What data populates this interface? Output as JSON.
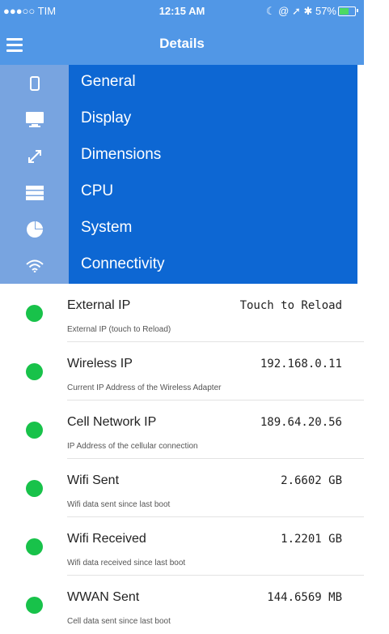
{
  "status_bar": {
    "carrier": "●●●○○ TIM",
    "time": "12:15 AM",
    "right_text": "☾ @ ➚ ✱ 57%",
    "battery_percent": 57
  },
  "nav": {
    "title": "Details"
  },
  "menu": {
    "items": [
      {
        "label": "General",
        "icon": "phone-icon"
      },
      {
        "label": "Display",
        "icon": "monitor-icon"
      },
      {
        "label": "Dimensions",
        "icon": "expand-icon"
      },
      {
        "label": "CPU",
        "icon": "server-icon"
      },
      {
        "label": "System",
        "icon": "pie-chart-icon"
      },
      {
        "label": "Connectivity",
        "icon": "wifi-icon"
      }
    ]
  },
  "rows": [
    {
      "name": "External IP",
      "value": "Touch to Reload",
      "desc": "External IP (touch to Reload)"
    },
    {
      "name": "Wireless IP",
      "value": "192.168.0.11",
      "desc": "Current IP Address of the Wireless Adapter"
    },
    {
      "name": "Cell Network IP",
      "value": "189.64.20.56",
      "desc": "IP Address of the cellular connection"
    },
    {
      "name": "Wifi Sent",
      "value": "2.6602 GB",
      "desc": "Wifi data sent since last boot"
    },
    {
      "name": "Wifi Received",
      "value": "1.2201 GB",
      "desc": "Wifi data received since last boot"
    },
    {
      "name": "WWAN Sent",
      "value": "144.6569 MB",
      "desc": "Cell data sent since last boot"
    }
  ],
  "colors": {
    "nav_blue": "#5197e6",
    "menu_blue": "#0d67d3",
    "menu_icon_strip": "#78a4e0",
    "status_green": "#18c24a"
  }
}
